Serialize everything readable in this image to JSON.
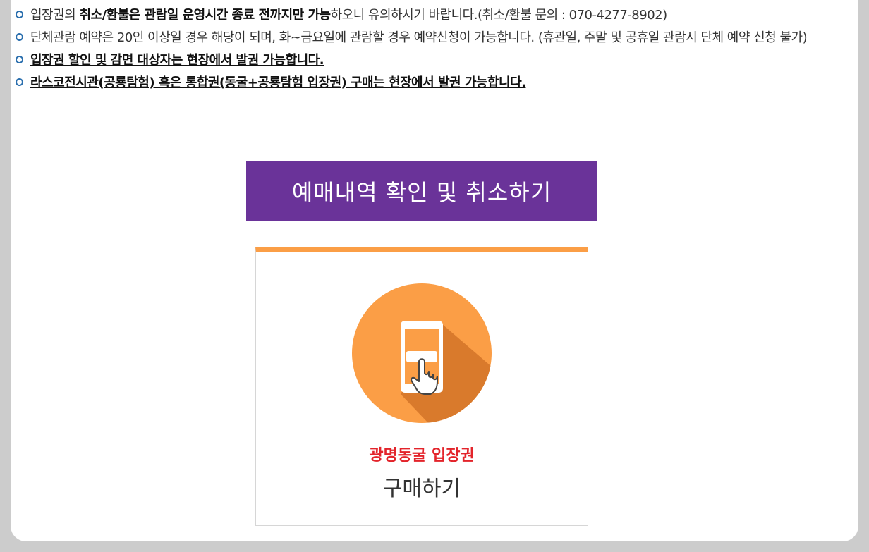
{
  "notices": [
    {
      "prefix": "입장권의 ",
      "emphasis": "취소/환불은 관람일 운영시간 종료 전까지만 가능",
      "suffix": "하오니 유의하시기 바랍니다.(취소/환불 문의 : 070-4277-8902)"
    },
    {
      "text": "단체관람 예약은 20인 이상일 경우 해당이 되며, 화~금요일에 관람할 경우 예약신청이 가능합니다. (휴관일, 주말 및 공휴일 관람시 단체 예약 신청 불가)"
    },
    {
      "emphasis": "입장권 할인 및 감면 대상자는 현장에서 발권 가능합니다."
    },
    {
      "emphasis": "라스코전시관(공룡탐험) 혹은 통합권(동굴+공룡탐험 입장권) 구매는 현장에서 발권 가능합니다."
    }
  ],
  "reservation_button": {
    "label": "예매내역 확인 및 취소하기",
    "color": "#6a3399"
  },
  "ticket_card": {
    "title": "광명동굴 입장권",
    "action": "구매하기",
    "icon": "smartphone-touch-icon",
    "accent_color": "#fb9e46",
    "title_color": "#e3242b"
  }
}
